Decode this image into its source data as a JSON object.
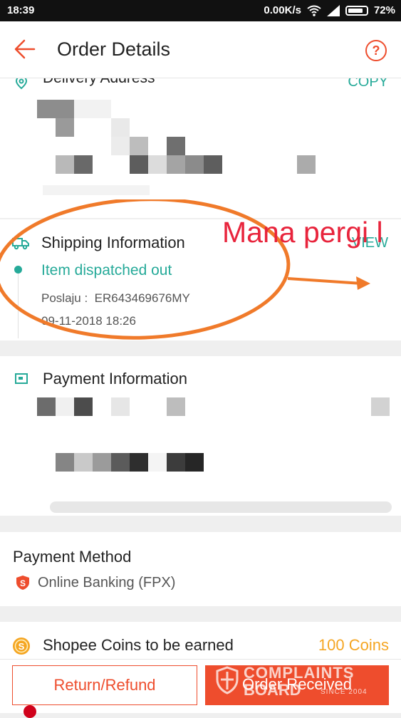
{
  "status_bar": {
    "time": "18:39",
    "network_speed": "0.00K/s",
    "battery": "72%"
  },
  "header": {
    "title": "Order Details",
    "help_symbol": "?"
  },
  "delivery": {
    "heading": "Delivery Address",
    "copy_label": "COPY"
  },
  "shipping": {
    "heading": "Shipping Information",
    "view_label": "VIEW",
    "status": "Item dispatched out",
    "tracking": "Poslaju :  ER643469676MY",
    "datetime": "09-11-2018 18:26"
  },
  "annotation": {
    "text": "Mana pergi l"
  },
  "payment_info": {
    "heading": "Payment Information"
  },
  "payment_method": {
    "heading": "Payment Method",
    "method": "Online Banking (FPX)"
  },
  "coins": {
    "label": "Shopee Coins to be earned",
    "value": "100 Coins"
  },
  "actions": {
    "refund_label": "Return/Refund",
    "received_label": "Order Received"
  },
  "watermark": {
    "line1": "COMPLAINTS",
    "line2": "BOARD",
    "line3": "SINCE 2004"
  },
  "colors": {
    "brand_orange": "#ee4d2d",
    "teal": "#26aa99",
    "coin_gold": "#f5a623"
  }
}
